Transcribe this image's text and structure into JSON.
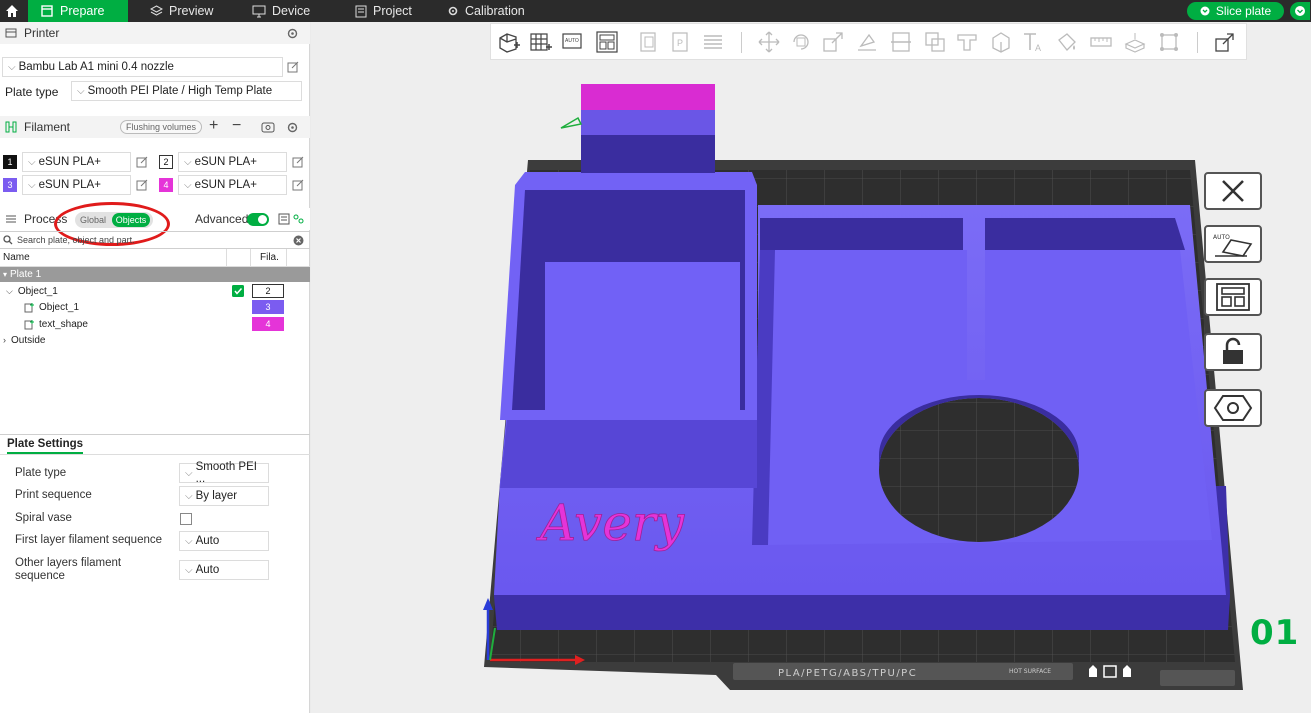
{
  "topbar": {
    "tabs": [
      {
        "label": "Prepare",
        "active": true
      },
      {
        "label": "Preview"
      },
      {
        "label": "Device"
      },
      {
        "label": "Project"
      },
      {
        "label": "Calibration"
      }
    ],
    "slice_button": "Slice plate"
  },
  "printer": {
    "section_label": "Printer",
    "printer_name": "Bambu Lab A1 mini 0.4 nozzle",
    "plate_type_label": "Plate type",
    "plate_type_value": "Smooth PEI Plate / High Temp Plate"
  },
  "filament": {
    "section_label": "Filament",
    "flushing_button": "Flushing volumes",
    "slots": [
      {
        "num": "1",
        "name": "eSUN PLA+",
        "color": "#111111"
      },
      {
        "num": "2",
        "name": "eSUN PLA+",
        "color": "#ffffff"
      },
      {
        "num": "3",
        "name": "eSUN PLA+",
        "color": "#7b5cf0"
      },
      {
        "num": "4",
        "name": "eSUN PLA+",
        "color": "#e534d8"
      }
    ]
  },
  "process": {
    "section_label": "Process",
    "global_label": "Global",
    "objects_label": "Objects",
    "advanced_label": "Advanced",
    "search_placeholder": "Search plate, object and part."
  },
  "object_list": {
    "col_name": "Name",
    "col_fila": "Fila.",
    "plate_label": "Plate 1",
    "rows": [
      {
        "name": "Object_1",
        "fila": "2",
        "fila_color": "#ffffff"
      },
      {
        "name": "Object_1",
        "fila": "3",
        "fila_color": "#7b5cf0"
      },
      {
        "name": "text_shape",
        "fila": "4",
        "fila_color": "#e534d8"
      }
    ],
    "outside_label": "Outside"
  },
  "plate_settings": {
    "tab_label": "Plate Settings",
    "rows": [
      {
        "label": "Plate type",
        "value": "Smooth PEI ..."
      },
      {
        "label": "Print sequence",
        "value": "By layer"
      },
      {
        "label": "Spiral vase",
        "value": ""
      },
      {
        "label": "First layer filament sequence",
        "value": "Auto"
      },
      {
        "label": "Other layers filament sequence",
        "value": "Auto"
      }
    ]
  },
  "viewport": {
    "model_text": "Avery",
    "plate_number": "01",
    "bed_label": "PLA/PETG/ABS/TPU/PC",
    "bed_label_2": "HOT SURFACE"
  },
  "colors": {
    "accent": "#00ae42",
    "model_purple": "#6f5cf4",
    "model_magenta": "#e534d8",
    "annotation_red": "#e01b1b"
  }
}
